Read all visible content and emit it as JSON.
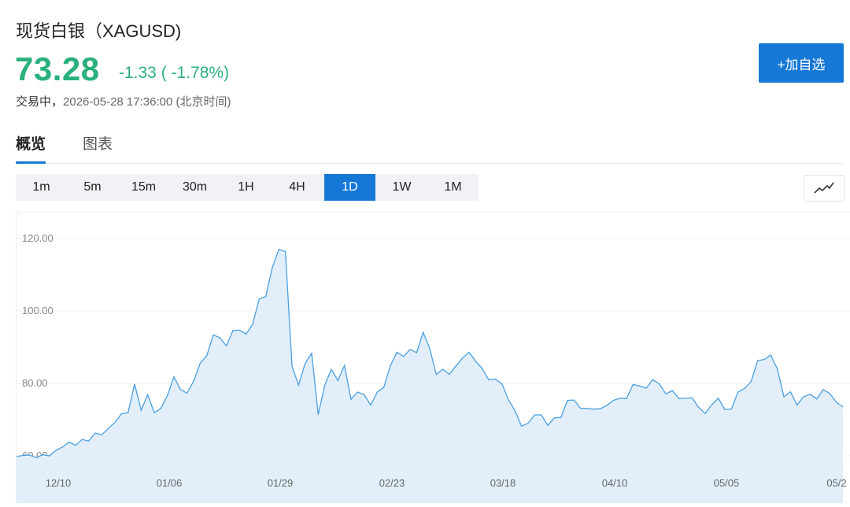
{
  "header": {
    "title": "现货白银（XAGUSD)",
    "price": "73.28",
    "change": "-1.33 ( -1.78%)",
    "status": "交易中",
    "separator": "，",
    "timestamp": "2026-05-28 17:36:00 (北京时间)",
    "watchlist_button": "+加自选"
  },
  "tabs": [
    {
      "label": "概览",
      "active": true
    },
    {
      "label": "图表",
      "active": false
    }
  ],
  "intervals": [
    {
      "label": "1m",
      "active": false
    },
    {
      "label": "5m",
      "active": false
    },
    {
      "label": "15m",
      "active": false
    },
    {
      "label": "30m",
      "active": false
    },
    {
      "label": "1H",
      "active": false
    },
    {
      "label": "4H",
      "active": false
    },
    {
      "label": "1D",
      "active": true
    },
    {
      "label": "1W",
      "active": false
    },
    {
      "label": "1M",
      "active": false
    }
  ],
  "chart_type_icon": "line-chart-icon",
  "colors": {
    "up_down_green": "#2bb07d",
    "accent_blue": "#1678d6",
    "line": "#4a9fe0",
    "area_fill": "#e2effb"
  },
  "chart_data": {
    "type": "area",
    "title": "",
    "xlabel": "",
    "ylabel": "",
    "ylim": [
      58,
      122
    ],
    "yticks": [
      "60.00",
      "80.00",
      "100.00",
      "120.00"
    ],
    "xticks": [
      "12/10",
      "01/06",
      "01/29",
      "02/23",
      "03/18",
      "04/10",
      "05/05",
      "05/2"
    ],
    "grid": true,
    "values": [
      59.8,
      60.1,
      60.2,
      59.5,
      60.3,
      60.0,
      61.5,
      62.4,
      63.8,
      62.9,
      64.5,
      64.1,
      66.3,
      65.8,
      67.6,
      69.2,
      71.6,
      71.9,
      79.8,
      72.6,
      76.9,
      71.9,
      73.1,
      76.6,
      81.8,
      78.3,
      77.3,
      80.6,
      85.6,
      87.6,
      93.4,
      92.6,
      90.4,
      94.6,
      94.7,
      93.6,
      96.3,
      103.3,
      104.0,
      112.0,
      117.0,
      116.4,
      84.8,
      79.5,
      85.5,
      88.3,
      71.4,
      79.5,
      83.9,
      80.8,
      84.9,
      75.6,
      77.6,
      76.9,
      74.0,
      77.6,
      78.9,
      84.9,
      88.6,
      87.4,
      89.4,
      88.5,
      94.1,
      89.6,
      82.5,
      83.9,
      82.5,
      84.8,
      87.0,
      88.6,
      86.1,
      84.1,
      81.0,
      81.2,
      79.9,
      75.5,
      72.5,
      68.2,
      69.0,
      71.3,
      71.3,
      68.4,
      70.5,
      70.6,
      75.3,
      75.4,
      73.1,
      73.1,
      72.9,
      73.0,
      73.9,
      75.3,
      75.9,
      75.8,
      79.7,
      79.3,
      78.7,
      81.0,
      79.9,
      77.1,
      78.0,
      75.8,
      75.9,
      76.0,
      73.4,
      71.7,
      74.1,
      75.9,
      72.8,
      72.9,
      77.6,
      78.6,
      80.5,
      86.3,
      86.6,
      87.8,
      84.0,
      76.3,
      77.7,
      74.0,
      76.3,
      77.0,
      75.7,
      78.3,
      77.2,
      74.8,
      73.5
    ]
  }
}
